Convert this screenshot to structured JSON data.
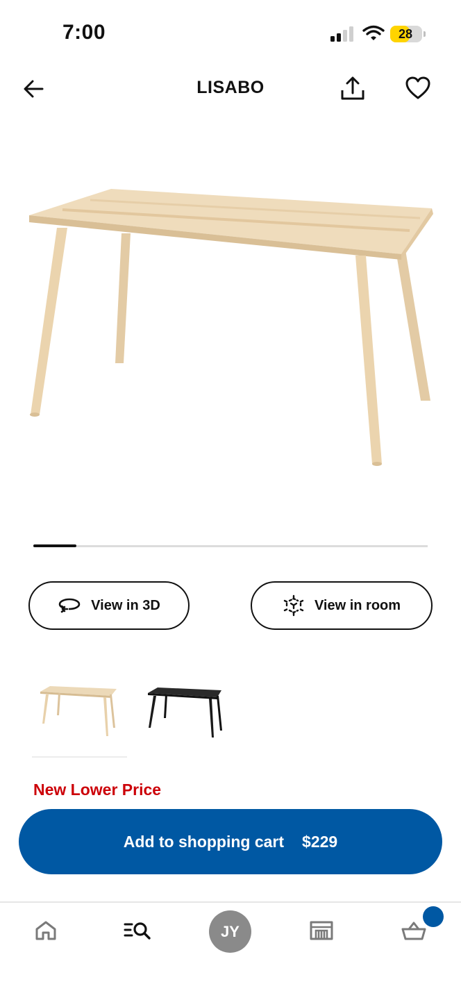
{
  "status_bar": {
    "time": "7:00",
    "battery": "28",
    "battery_level": 0.28
  },
  "header": {
    "title": "LISABO"
  },
  "carousel": {
    "current_index": 1
  },
  "view_buttons": {
    "view_3d": "View in 3D",
    "view_room": "View in room"
  },
  "variants": [
    {
      "color": "#e9d4b4"
    },
    {
      "color": "#1f1f1f"
    }
  ],
  "promo": {
    "label": "New Lower Price"
  },
  "cart_button": {
    "label": "Add to shopping cart",
    "price": "$229"
  },
  "bottom_nav": {
    "avatar_initials": "JY"
  },
  "colors": {
    "accent": "#0058a3",
    "promo": "#cc0008",
    "wood": "#ead7b8"
  }
}
